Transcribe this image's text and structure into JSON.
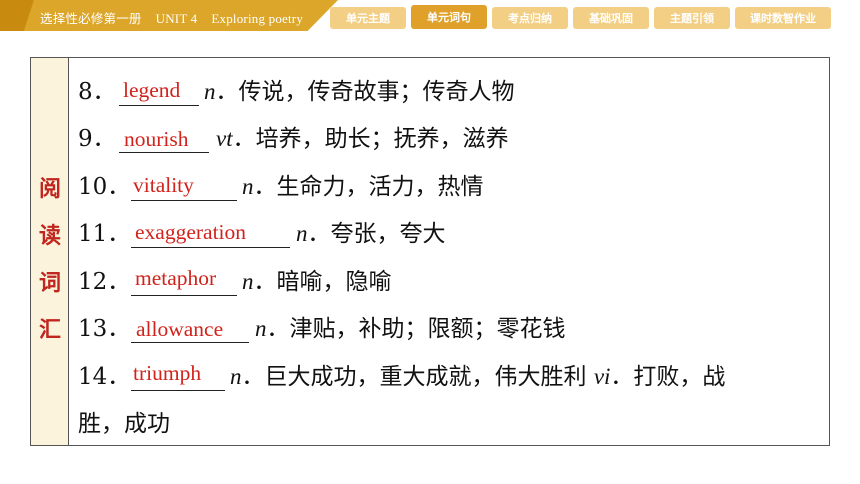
{
  "header": {
    "book": "选择性必修第一册",
    "unit": "UNIT 4",
    "unit_title": "Exploring poetry"
  },
  "tabs": [
    "单元主题",
    "单元词句",
    "考点归纳",
    "基础巩固",
    "主题引领",
    "课时数智作业"
  ],
  "active_tab": "单元词句",
  "side_label": [
    "阅",
    "读",
    "词",
    "汇"
  ],
  "vocab": [
    {
      "num": "8．",
      "answer": "legend",
      "pos": "n",
      "meaning": "．传说，传奇故事；传奇人物"
    },
    {
      "num": "9．",
      "answer": "nourish",
      "pos": "vt",
      "meaning": "．培养，助长；抚养，滋养"
    },
    {
      "num": "10．",
      "answer": "vitality",
      "pos": "n",
      "meaning": "．生命力，活力，热情"
    },
    {
      "num": "11．",
      "answer": "exaggeration",
      "pos": "n",
      "meaning": "．夸张，夸大"
    },
    {
      "num": "12．",
      "answer": "metaphor",
      "pos": "n",
      "meaning": "．暗喻，隐喻"
    },
    {
      "num": "13．",
      "answer": "allowance",
      "pos": "n",
      "meaning": "．津贴，补助；限额；零花钱"
    },
    {
      "num": "14．",
      "answer": "triumph",
      "pos": "n",
      "meaning": "．巨大成功，重大成就，伟大胜利 ",
      "pos2": "vi",
      "meaning2": "．打败，战"
    }
  ],
  "continuation": "胜，成功",
  "colors": {
    "accent": "#dba62a",
    "answer_red": "#d1231c",
    "side_bg": "#fbf3dc"
  }
}
